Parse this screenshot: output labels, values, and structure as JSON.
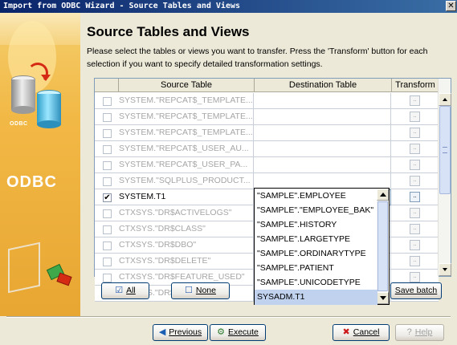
{
  "window": {
    "title": "Import from ODBC Wizard - Source Tables and Views"
  },
  "brand": {
    "logo_small": "ODBC",
    "logo_big": "ODBC"
  },
  "heading": "Source Tables and Views",
  "description": "Please select the tables or views you want to transfer. Press the 'Transform' button for each selection if you want to specify detailed transformation settings.",
  "grid": {
    "columns": [
      "Source Table",
      "Destination Table",
      "Transform"
    ],
    "rows": [
      {
        "checked": false,
        "source": "SYSTEM.\"REPCAT$_TEMPLATE...",
        "destination": "",
        "active": false
      },
      {
        "checked": false,
        "source": "SYSTEM.\"REPCAT$_TEMPLATE...",
        "destination": "",
        "active": false
      },
      {
        "checked": false,
        "source": "SYSTEM.\"REPCAT$_TEMPLATE...",
        "destination": "",
        "active": false
      },
      {
        "checked": false,
        "source": "SYSTEM.\"REPCAT$_USER_AU...",
        "destination": "",
        "active": false
      },
      {
        "checked": false,
        "source": "SYSTEM.\"REPCAT$_USER_PA...",
        "destination": "",
        "active": false
      },
      {
        "checked": false,
        "source": "SYSTEM.\"SQLPLUS_PRODUCT...",
        "destination": "",
        "active": false
      },
      {
        "checked": true,
        "source": "SYSTEM.T1",
        "destination": "SYSADM.T1",
        "active": true
      },
      {
        "checked": false,
        "source": "CTXSYS.\"DR$ACTIVELOGS\"",
        "destination": "",
        "active": false
      },
      {
        "checked": false,
        "source": "CTXSYS.\"DR$CLASS\"",
        "destination": "",
        "active": false
      },
      {
        "checked": false,
        "source": "CTXSYS.\"DR$DBO\"",
        "destination": "",
        "active": false
      },
      {
        "checked": false,
        "source": "CTXSYS.\"DR$DELETE\"",
        "destination": "",
        "active": false
      },
      {
        "checked": false,
        "source": "CTXSYS.\"DR$FEATURE_USED\"",
        "destination": "",
        "active": false
      },
      {
        "checked": false,
        "source": "CTXSYS.\"DR$FREQTOKS\"",
        "destination": "",
        "active": false
      }
    ],
    "transform_glyph": "..",
    "check_glyph": "✔"
  },
  "dropdown": {
    "options": [
      "\"SAMPLE\".EMPLOYEE",
      "\"SAMPLE\".\"EMPLOYEE_BAK\"",
      "\"SAMPLE\".HISTORY",
      "\"SAMPLE\".LARGETYPE",
      "\"SAMPLE\".ORDINARYTYPE",
      "\"SAMPLE\".PATIENT",
      "\"SAMPLE\".UNICODETYPE",
      "SYSADM.T1"
    ],
    "selected_index": 7
  },
  "buttons": {
    "all": {
      "label": "All",
      "icon": "select-all-icon"
    },
    "none": {
      "label": "None",
      "icon": "select-none-icon"
    },
    "save_batch": {
      "label": "Save batch"
    },
    "previous": {
      "label": "Previous",
      "icon": "previous-arrow-icon"
    },
    "execute": {
      "label": "Execute",
      "icon": "execute-icon"
    },
    "cancel": {
      "label": "Cancel",
      "icon": "cancel-x-icon"
    },
    "help": {
      "label": "Help",
      "icon": "help-icon"
    }
  },
  "colors": {
    "title_bar": "#0a246a",
    "selection": "#c1d2ee",
    "cancel_icon": "#cc1a1a"
  }
}
